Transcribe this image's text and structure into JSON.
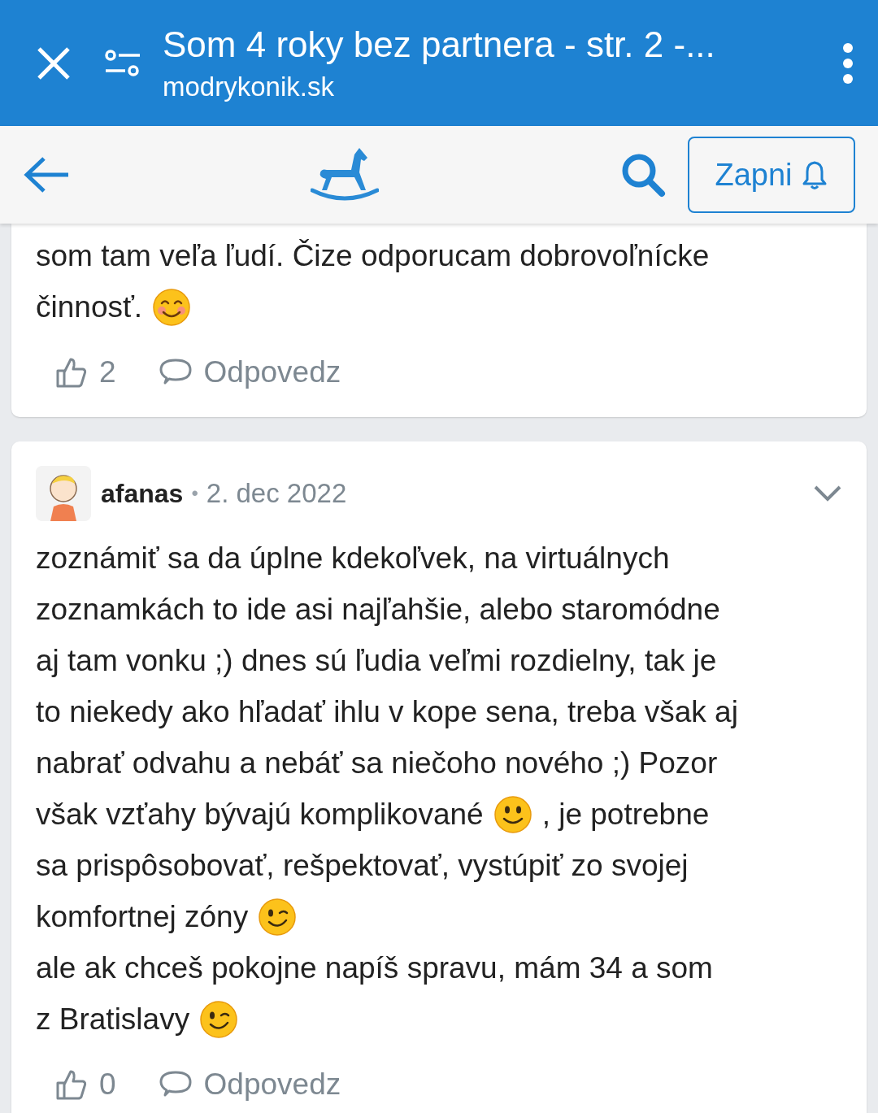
{
  "browser_bar": {
    "title": "Som 4 roky bez partnera - str. 2 -...",
    "url": "modrykonik.sk"
  },
  "toolbar": {
    "notify_button": "Zapni"
  },
  "comments": [
    {
      "lines": [
        [
          {
            "kind": "text",
            "text": "som tam veľa ľudí. Čize odporucam dobrovoľnícke"
          }
        ],
        [
          {
            "kind": "text",
            "text": "činnosť."
          },
          {
            "kind": "blush"
          }
        ]
      ],
      "likes": "2",
      "reply": "Odpovedz"
    },
    {
      "author": "afanas",
      "separator": "•",
      "date": "2. dec 2022",
      "lines": [
        [
          {
            "kind": "text",
            "text": "zoznámiť sa da úplne kdekoľvek, na virtuálnych"
          }
        ],
        [
          {
            "kind": "text",
            "text": "zoznamkách to ide asi najľahšie, alebo staromódne"
          }
        ],
        [
          {
            "kind": "text",
            "text": "aj tam vonku ;) dnes sú ľudia veľmi rozdielny, tak je"
          }
        ],
        [
          {
            "kind": "text",
            "text": "to niekedy ako hľadať ihlu v kope sena, treba však aj"
          }
        ],
        [
          {
            "kind": "text",
            "text": "nabrať odvahu a nebáť sa niečoho nového ;) Pozor"
          }
        ],
        [
          {
            "kind": "text",
            "text": "však vzťahy bývajú komplikované"
          },
          {
            "kind": "smile"
          },
          {
            "kind": "text",
            "text": ", je potrebne"
          }
        ],
        [
          {
            "kind": "text",
            "text": "sa prispôsobovať, rešpektovať, vystúpiť zo svojej"
          }
        ],
        [
          {
            "kind": "text",
            "text": "komfortnej zóny"
          },
          {
            "kind": "wink"
          }
        ],
        [
          {
            "kind": "text",
            "text": "ale ak chceš pokojne napíš spravu, mám 34 a som"
          }
        ],
        [
          {
            "kind": "text",
            "text": "z Bratislavy"
          },
          {
            "kind": "wink"
          }
        ]
      ],
      "likes": "0",
      "reply": "Odpovedz"
    }
  ]
}
